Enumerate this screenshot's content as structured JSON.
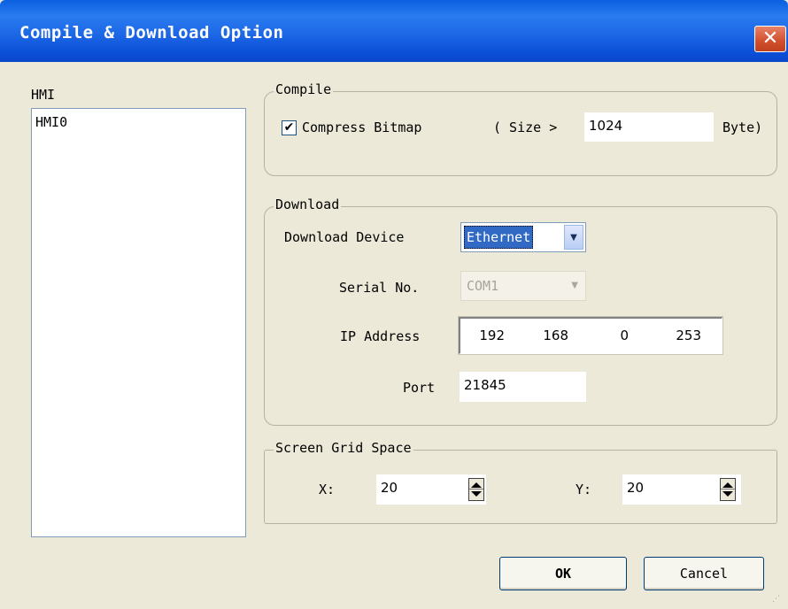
{
  "window": {
    "title": "Compile & Download Option",
    "close_icon_glyph": "✕"
  },
  "hmi_list": {
    "label": "HMI",
    "items": [
      "HMI0"
    ]
  },
  "compile": {
    "legend": "Compile",
    "compress_checked": true,
    "check_glyph": "✔",
    "compress_label": "Compress Bitmap",
    "size_prefix": "( Size >",
    "size_value": "1024",
    "size_unit": "Byte)"
  },
  "download": {
    "legend": "Download",
    "device_label": "Download Device",
    "device_value": "Ethernet",
    "dropdown_arrow": "▼",
    "serial_label": "Serial No.",
    "serial_value": "COM1",
    "serial_arrow": "▼",
    "ip_label": "IP Address",
    "ip": [
      "192",
      "168",
      "0",
      "253"
    ],
    "port_label": "Port",
    "port_value": "21845"
  },
  "grid": {
    "legend": "Screen Grid Space",
    "x_label": "X:",
    "x_value": "20",
    "y_label": "Y:",
    "y_value": "20"
  },
  "buttons": {
    "ok": "OK",
    "cancel": "Cancel"
  },
  "colors": {
    "titlebar": "#0a5fe0",
    "face": "#ece9d8",
    "selection": "#316ac5",
    "close": "#d04f2c"
  }
}
